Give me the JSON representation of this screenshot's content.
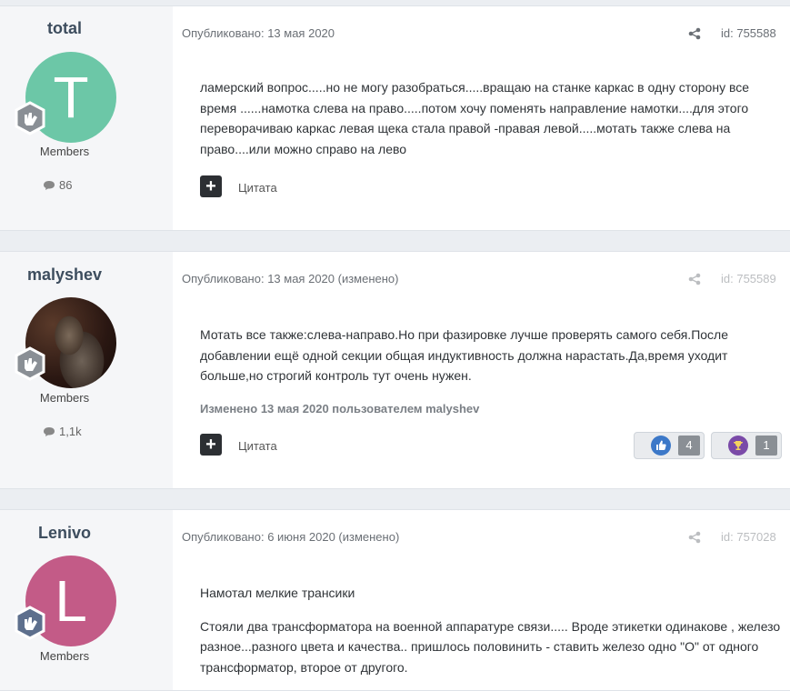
{
  "colors": {
    "avatar_total": "#6cc7a7",
    "avatar_lenivo": "#c35b87",
    "like_blue": "#3c78c8",
    "trophy_purple": "#7a4aa8"
  },
  "posts": [
    {
      "author": "total",
      "avatar_letter": "T",
      "role": "Members",
      "post_count": "86",
      "meta": "Опубликовано: 13 мая 2020",
      "post_id": "id: 755588",
      "body": [
        "ламерский вопрос.....но не могу разобраться.....вращаю на станке  каркас в одну сторону все время ......намотка слева на право.....потом хочу поменять направление намотки....для этого переворачиваю каркас левая щека стала правой -правая левой.....мотать также слева на право....или можно справо на лево"
      ],
      "quote_label": "Цитата"
    },
    {
      "author": "malyshev",
      "role": "Members",
      "post_count": "1,1k",
      "meta": "Опубликовано: 13 мая 2020 (изменено)",
      "post_id": "id: 755589",
      "body": [
        "Мотать все также:слева-направо.Но при фазировке лучше проверять самого себя.После добавлении ещё одной секции общая индуктивность должна нарастать.Да,время уходит больше,но строгий контроль тут очень нужен."
      ],
      "edited_note": "Изменено 13 мая 2020 пользователем malyshev",
      "quote_label": "Цитата",
      "reactions": [
        {
          "icon": "thumbs-up-icon",
          "count": "4"
        },
        {
          "icon": "trophy-icon",
          "count": "1"
        }
      ]
    },
    {
      "author": "Lenivo",
      "avatar_letter": "L",
      "role": "Members",
      "meta": "Опубликовано: 6 июня 2020 (изменено)",
      "post_id": "id: 757028",
      "body": [
        "Намотал мелкие трансики",
        "Стояли два трансформатора на военной аппаратуре связи..... Вроде этикетки одинакове , железо разное...разного цвета и качества.. пришлось половинить - ставить железо  одно \"О\" от одного трансформатор, второе от другого."
      ]
    }
  ]
}
